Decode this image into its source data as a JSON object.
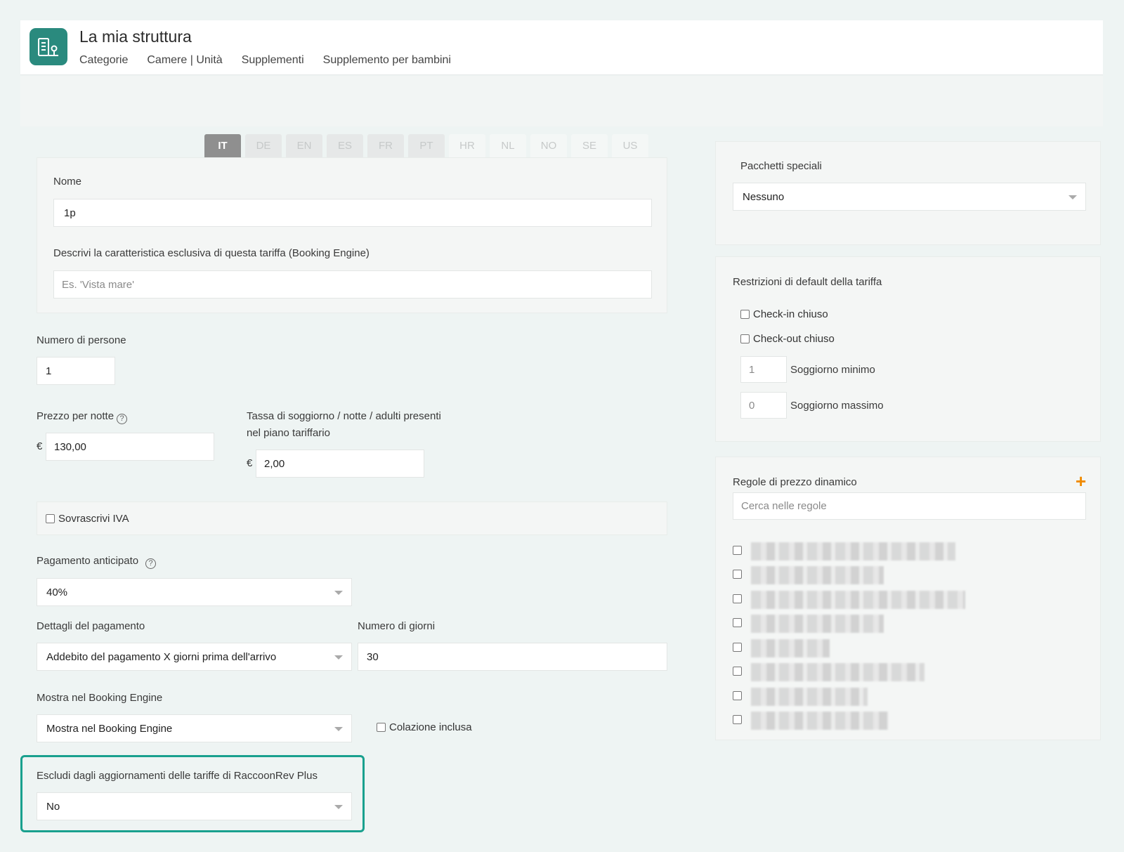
{
  "header": {
    "title": "La mia struttura",
    "nav": [
      "Categorie",
      "Camere | Unità",
      "Supplementi",
      "Supplemento per bambini"
    ]
  },
  "languages": {
    "tabs": [
      "IT",
      "DE",
      "EN",
      "ES",
      "FR",
      "PT",
      "HR",
      "NL",
      "NO",
      "SE",
      "US"
    ],
    "active": "IT"
  },
  "form": {
    "nome_label": "Nome",
    "nome_value": "1p",
    "descr_label": "Descrivi la caratteristica esclusiva di questa tariffa (Booking Engine)",
    "descr_placeholder": "Es. 'Vista mare'",
    "persone_label": "Numero di persone",
    "persone_value": "1",
    "prezzo_label": "Prezzo per notte",
    "prezzo_currency": "€",
    "prezzo_value": "130,00",
    "tassa_label_1": "Tassa di soggiorno / notte / adulti presenti",
    "tassa_label_2": "nel piano tariffario",
    "tassa_currency": "€",
    "tassa_value": "2,00",
    "iva_label": "Sovrascrivi IVA",
    "anticipo_label": "Pagamento anticipato",
    "anticipo_value": "40%",
    "dettagli_label": "Dettagli del pagamento",
    "dettagli_value": "Addebito del pagamento X giorni prima dell'arrivo",
    "giorni_label": "Numero di giorni",
    "giorni_value": "30",
    "mostra_label": "Mostra nel Booking Engine",
    "mostra_value": "Mostra nel Booking Engine",
    "colazione_label": "Colazione inclusa",
    "escludi_label": "Escludi dagli aggiornamenti delle tariffe di RaccoonRev Plus",
    "escludi_value": "No"
  },
  "sidebar": {
    "pacchetti_label": "Pacchetti speciali",
    "pacchetti_value": "Nessuno",
    "restrizioni_label": "Restrizioni di default della tariffa",
    "checkin_label": "Check-in chiuso",
    "checkout_label": "Check-out chiuso",
    "min_value": "1",
    "min_label": "Soggiorno minimo",
    "max_value": "0",
    "max_label": "Soggiorno massimo",
    "regole_label": "Regole di prezzo dinamico",
    "regole_placeholder": "Cerca nelle regole"
  },
  "colors": {
    "brand": "#2a8a7e",
    "highlight": "#19a08e",
    "plus": "#f08a00"
  }
}
